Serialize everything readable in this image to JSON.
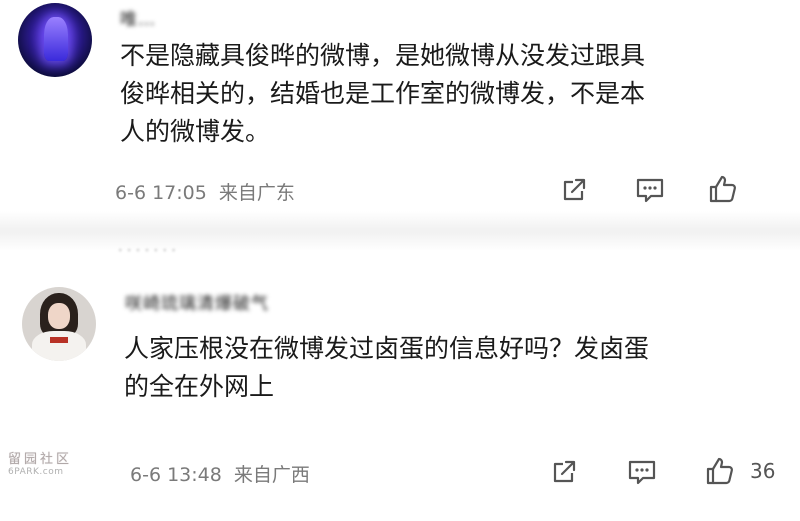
{
  "comments": [
    {
      "username": "唯…",
      "content_lines": [
        "不是隐藏具俊晔的微博，是她微博从没发过跟具",
        "俊晔相关的，结婚也是工作室的微博发，不是本",
        "人的微博发。"
      ],
      "time": "6-6 17:05",
      "location": "来自广东",
      "like_count": ""
    },
    {
      "username": "咲崎琉璃清爆破气",
      "content_lines": [
        "人家压根没在微博发过卤蛋的信息好吗？发卤蛋",
        "的全在外网上"
      ],
      "time": "6-6 13:48",
      "location": "来自广西",
      "like_count": "36"
    }
  ],
  "partial_username": "· · ·  · · · ·",
  "watermark": {
    "line1": "留园社区",
    "line2": "6PARK.com"
  },
  "icons": {
    "share": "share-icon",
    "comment": "comment-icon",
    "like": "thumbs-up-icon"
  },
  "colors": {
    "text": "#1a1a1a",
    "meta": "#7a7a7a",
    "icon": "#555555"
  }
}
